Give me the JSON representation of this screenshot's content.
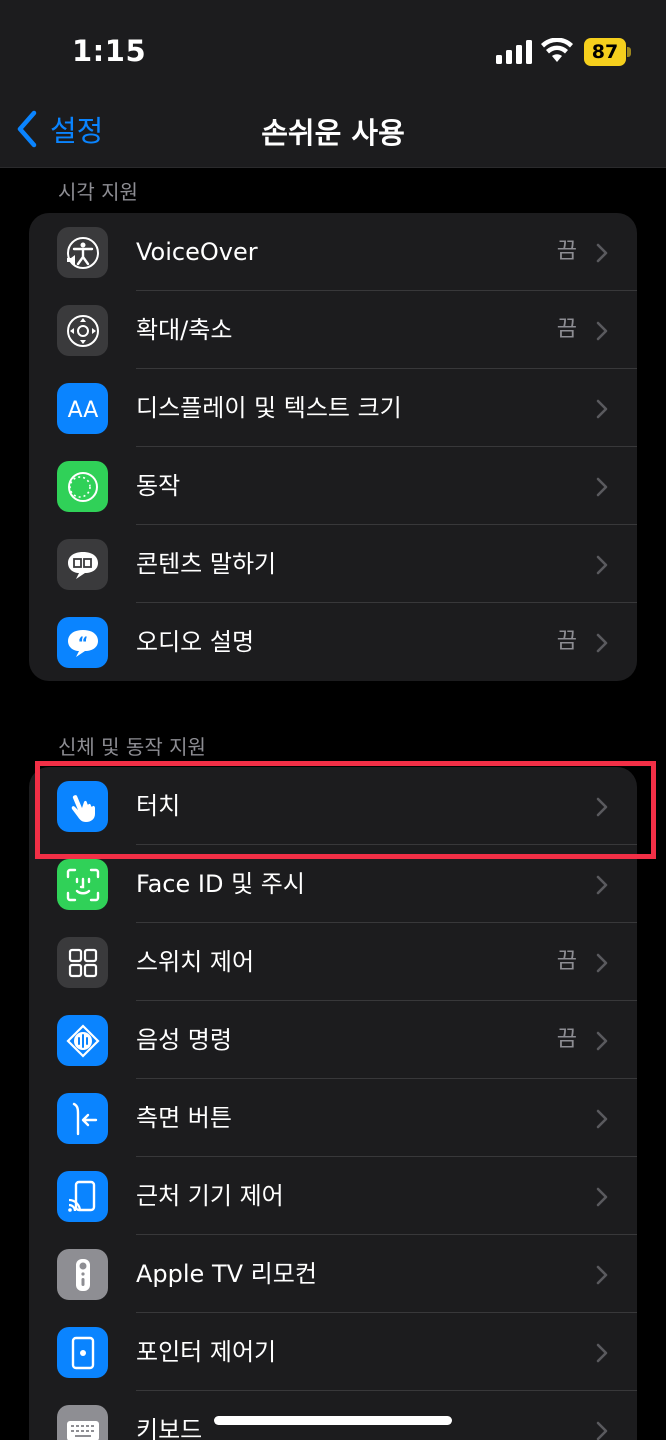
{
  "status": {
    "time": "1:15",
    "battery": "87"
  },
  "nav": {
    "back_label": "설정",
    "title": "손쉬운 사용"
  },
  "sections": [
    {
      "header": "시각 지원",
      "items": [
        {
          "label": "VoiceOver",
          "value": "끔",
          "icon": "voiceover-icon",
          "color": "#3a3a3c"
        },
        {
          "label": "확대/축소",
          "value": "끔",
          "icon": "zoom-icon",
          "color": "#3a3a3c"
        },
        {
          "label": "디스플레이 및 텍스트 크기",
          "value": "",
          "icon": "text-size-icon",
          "color": "#0a84ff"
        },
        {
          "label": "동작",
          "value": "",
          "icon": "motion-icon",
          "color": "#30d158"
        },
        {
          "label": "콘텐츠 말하기",
          "value": "",
          "icon": "spoken-content-icon",
          "color": "#3a3a3c"
        },
        {
          "label": "오디오 설명",
          "value": "끔",
          "icon": "audio-description-icon",
          "color": "#0a84ff"
        }
      ]
    },
    {
      "header": "신체 및 동작 지원",
      "items": [
        {
          "label": "터치",
          "value": "",
          "icon": "touch-hand-icon",
          "color": "#0a84ff"
        },
        {
          "label": "Face ID 및 주시",
          "value": "",
          "icon": "face-id-icon",
          "color": "#30d158"
        },
        {
          "label": "스위치 제어",
          "value": "끔",
          "icon": "switch-control-icon",
          "color": "#3a3a3c"
        },
        {
          "label": "음성 명령",
          "value": "끔",
          "icon": "voice-control-icon",
          "color": "#0a84ff"
        },
        {
          "label": "측면 버튼",
          "value": "",
          "icon": "side-button-icon",
          "color": "#0a84ff"
        },
        {
          "label": "근처 기기 제어",
          "value": "",
          "icon": "nearby-devices-icon",
          "color": "#0a84ff"
        },
        {
          "label": "Apple TV 리모컨",
          "value": "",
          "icon": "apple-tv-remote-icon",
          "color": "#8e8e93"
        },
        {
          "label": "포인터 제어기",
          "value": "",
          "icon": "pointer-control-icon",
          "color": "#0a84ff"
        },
        {
          "label": "키보드",
          "value": "",
          "icon": "keyboard-icon",
          "color": "#8e8e93"
        }
      ]
    }
  ],
  "accent_color": "#0a84ff",
  "highlight_color": "#f22f46"
}
